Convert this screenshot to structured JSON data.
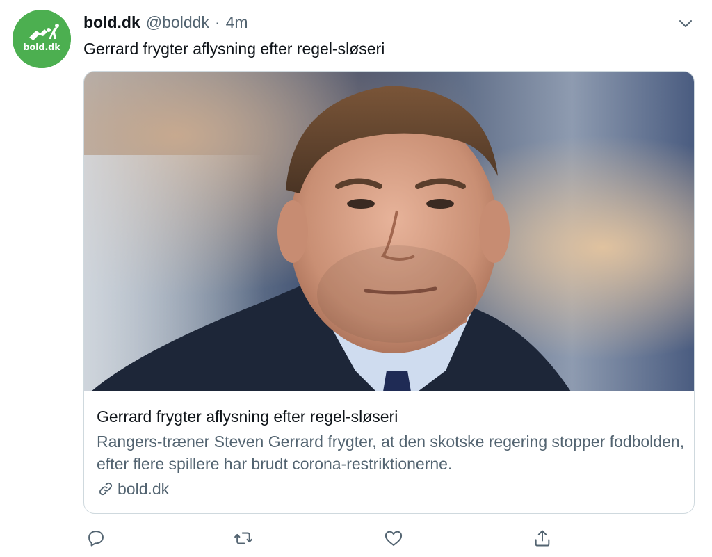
{
  "author": {
    "avatar_text": "bold.dk",
    "display_name": "bold.dk",
    "handle": "@bolddk",
    "separator": "·",
    "time": "4m"
  },
  "tweet": {
    "text": "Gerrard frygter aflysning efter regel-sløseri"
  },
  "card": {
    "title": "Gerrard frygter aflysning efter regel-sløseri",
    "description": "Rangers-træner Steven Gerrard frygter, at den skotske regering stopper fodbolden, efter flere spillere har brudt corona-restriktionerne.",
    "domain": "bold.dk",
    "link_icon": "link-icon",
    "image_icon": "photo"
  },
  "actions": [
    {
      "icon": "reply-icon"
    },
    {
      "icon": "retweet-icon"
    },
    {
      "icon": "like-icon"
    },
    {
      "icon": "share-icon"
    }
  ],
  "colors": {
    "avatar_bg": "#4caf50",
    "secondary_text": "#536471",
    "primary_text": "#0f1419",
    "border": "#cfd9de"
  }
}
